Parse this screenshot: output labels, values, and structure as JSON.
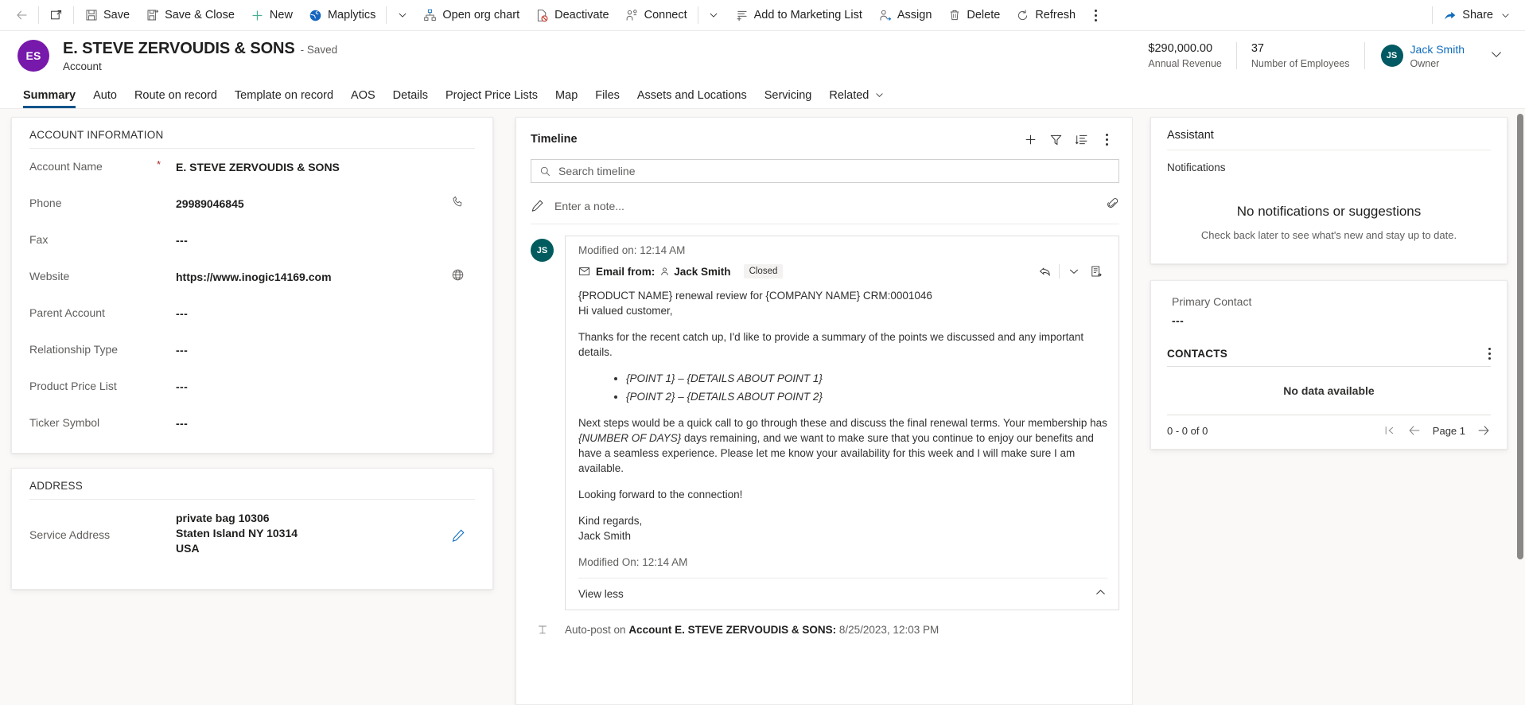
{
  "command_bar": {
    "back_label": "Back",
    "popout_label": "Open in new window",
    "items": [
      {
        "label": "Save",
        "icon": "save-icon"
      },
      {
        "label": "Save & Close",
        "icon": "save-close-icon"
      },
      {
        "label": "New",
        "icon": "plus-icon"
      },
      {
        "label": "Maplytics",
        "icon": "maplytics-icon"
      },
      {
        "label": "Open org chart",
        "icon": "org-chart-icon"
      },
      {
        "label": "Deactivate",
        "icon": "deactivate-icon"
      },
      {
        "label": "Connect",
        "icon": "connect-icon"
      },
      {
        "label": "Add to Marketing List",
        "icon": "marketing-list-icon"
      },
      {
        "label": "Assign",
        "icon": "assign-icon"
      },
      {
        "label": "Delete",
        "icon": "delete-icon"
      },
      {
        "label": "Refresh",
        "icon": "refresh-icon"
      }
    ],
    "overflow_label": "More commands",
    "share_label": "Share"
  },
  "record_header": {
    "avatar_initials": "ES",
    "title": "E. STEVE ZERVOUDIS & SONS",
    "saved_state": "- Saved",
    "entity": "Account",
    "fields": [
      {
        "value": "$290,000.00",
        "label": "Annual Revenue"
      },
      {
        "value": "37",
        "label": "Number of Employees"
      }
    ],
    "owner": {
      "initials": "JS",
      "name": "Jack Smith",
      "role": "Owner"
    }
  },
  "tabs": [
    {
      "label": "Summary",
      "active": true
    },
    {
      "label": "Auto",
      "active": false
    },
    {
      "label": "Route on record",
      "active": false
    },
    {
      "label": "Template on record",
      "active": false
    },
    {
      "label": "AOS",
      "active": false
    },
    {
      "label": "Details",
      "active": false
    },
    {
      "label": "Project Price Lists",
      "active": false
    },
    {
      "label": "Map",
      "active": false
    },
    {
      "label": "Files",
      "active": false
    },
    {
      "label": "Assets and Locations",
      "active": false
    },
    {
      "label": "Servicing",
      "active": false
    },
    {
      "label": "Related",
      "active": false,
      "has_chevron": true
    }
  ],
  "account_information": {
    "section_title": "ACCOUNT INFORMATION",
    "fields": [
      {
        "label": "Account Name",
        "value": "E. STEVE ZERVOUDIS & SONS",
        "required": true,
        "icon": null
      },
      {
        "label": "Phone",
        "value": "29989046845",
        "required": false,
        "icon": "phone-icon"
      },
      {
        "label": "Fax",
        "value": "---",
        "required": false,
        "icon": null
      },
      {
        "label": "Website",
        "value": "https://www.inogic14169.com",
        "required": false,
        "icon": "globe-icon"
      },
      {
        "label": "Parent Account",
        "value": "---",
        "required": false,
        "icon": null
      },
      {
        "label": "Relationship Type",
        "value": "---",
        "required": false,
        "icon": null
      },
      {
        "label": "Product Price List",
        "value": "---",
        "required": false,
        "icon": null
      },
      {
        "label": "Ticker Symbol",
        "value": "---",
        "required": false,
        "icon": null
      }
    ]
  },
  "address": {
    "section_title": "ADDRESS",
    "field_label": "Service Address",
    "lines": [
      "private bag 10306",
      "Staten Island NY 10314",
      "USA"
    ],
    "edit_icon": "pencil-icon"
  },
  "timeline": {
    "title": "Timeline",
    "actions": [
      {
        "name": "create-timeline-record",
        "icon": "plus-icon"
      },
      {
        "name": "filter-timeline",
        "icon": "filter-icon"
      },
      {
        "name": "sort-timeline",
        "icon": "sort-icon"
      },
      {
        "name": "timeline-more-commands",
        "icon": "more-icon"
      }
    ],
    "search_placeholder": "Search timeline",
    "note_placeholder": "Enter a note...",
    "attach_icon": "paperclip-icon",
    "entry": {
      "avatar_initials": "JS",
      "modified_on": "Modified on: 12:14 AM",
      "record_type": "Email from:",
      "person": "Jack Smith",
      "status_badge": "Closed",
      "subject": "{PRODUCT NAME} renewal review for {COMPANY NAME} CRM:0001046",
      "greeting": "Hi valued customer,",
      "paragraph1": "Thanks for the recent catch up, I'd like to provide a summary of the points we discussed and any important details.",
      "bullets": [
        "{POINT 1} – {DETAILS ABOUT POINT 1}",
        "{POINT 2} – {DETAILS ABOUT POINT 2}"
      ],
      "paragraph2_a": "Next steps would be a quick call to go through these and discuss the final renewal terms. Your membership has ",
      "paragraph2_em": "{NUMBER OF DAYS}",
      "paragraph2_b": " days remaining, and we want to make sure that you continue to enjoy our benefits and have a seamless experience. Please let me know your availability for this week and I will make sure I am available.",
      "paragraph3": "Looking forward to the connection!",
      "signoff": "Kind regards,",
      "signature": "Jack Smith",
      "footer_modified": "Modified On: 12:14 AM",
      "view_less": "View less",
      "reply_icon": "reply-icon",
      "expand_icon": "chevron-down-icon",
      "details_icon": "open-record-icon"
    },
    "autopost": {
      "prefix": "Auto-post on ",
      "record": "Account E. STEVE ZERVOUDIS & SONS:",
      "timestamp": "8/25/2023, 12:03 PM",
      "icon": "autopost-icon"
    }
  },
  "assistant": {
    "title": "Assistant",
    "subtitle": "Notifications",
    "empty_heading": "No notifications or suggestions",
    "empty_body": "Check back later to see what's new and stay up to date."
  },
  "contacts_panel": {
    "primary_contact_label": "Primary Contact",
    "primary_contact_value": "---",
    "section_title": "CONTACTS",
    "more_icon": "more-icon",
    "no_data": "No data available",
    "record_count": "0 - 0 of 0",
    "page_label": "Page 1",
    "nav": [
      {
        "name": "first-page-button",
        "icon": "first-page-icon"
      },
      {
        "name": "previous-page-button",
        "icon": "previous-page-icon"
      },
      {
        "name": "next-page-button",
        "icon": "next-page-icon"
      }
    ]
  },
  "colors": {
    "accent": "#0f6cbd",
    "tab_underline": "#0f548c",
    "avatar_purple": "#7719aa",
    "avatar_teal": "#015a63",
    "required_red": "#a4262c"
  }
}
